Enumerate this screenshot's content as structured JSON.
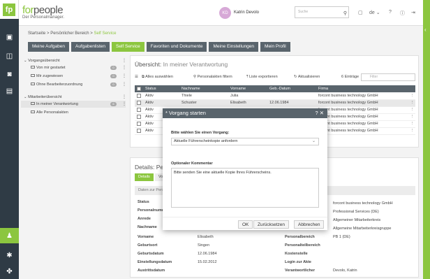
{
  "app": {
    "brand_left": "for",
    "brand_right": "people",
    "tagline": "Der Personalmanager."
  },
  "header": {
    "user_initials": "KD",
    "user_name": "Katrin Devolo",
    "search_placeholder": "Suche",
    "language": "de"
  },
  "breadcrumb": {
    "items": [
      "Startseite",
      "Persönlicher Bereich",
      "Self Service"
    ],
    "separator": ">"
  },
  "tabs": [
    {
      "label": "Meine Aufgaben",
      "active": false
    },
    {
      "label": "Aufgabenlisten",
      "active": false
    },
    {
      "label": "Self Service",
      "active": true
    },
    {
      "label": "Favoriten und Dokumente",
      "active": false
    },
    {
      "label": "Meine Einstellungen",
      "active": false
    },
    {
      "label": "Mein Profil",
      "active": false
    }
  ],
  "tree": {
    "group1": {
      "label": "Vorgangsübersicht",
      "items": [
        {
          "label": "Von mir gestartet",
          "badge": "0"
        },
        {
          "label": "Mir zugewiesen",
          "badge": "0"
        },
        {
          "label": "Ohne Bearbeiterzuordnung",
          "badge": "0"
        }
      ]
    },
    "group2": {
      "label": "Mitarbeiterübersicht",
      "items": [
        {
          "label": "In meiner Verantwortung",
          "badge": "6"
        },
        {
          "label": "Alle Personalakten",
          "badge": ""
        }
      ]
    }
  },
  "overview": {
    "title": "Übersicht:",
    "subtitle": "In meiner Verantwortung",
    "toolbar": {
      "select_all": "Alles auswählen",
      "filter": "Personalakten filtern",
      "export": "Liste exportieren",
      "refresh": "Aktualisieren",
      "count": "6 Einträge",
      "filter_placeholder": "Filter"
    },
    "columns": [
      "Status",
      "Nachname",
      "Vorname",
      "Geb.-Datum",
      "Firma"
    ],
    "rows": [
      [
        "Aktiv",
        "Thiele",
        "Julia",
        "",
        "forcont business technology GmbH"
      ],
      [
        "Aktiv",
        "Schuster",
        "Elisabeth",
        "12.06.1984",
        "forcont business technology GmbH"
      ],
      [
        "Aktiv",
        "",
        "",
        "",
        "forcont business technology GmbH"
      ],
      [
        "Aktiv",
        "",
        "",
        "",
        "forcont business technology GmbH"
      ],
      [
        "Aktiv",
        "",
        "",
        "",
        "forcont business technology GmbH"
      ],
      [
        "Aktiv",
        "",
        "",
        "",
        "forcont business technology GmbH"
      ]
    ]
  },
  "details": {
    "title": "Details: Pers",
    "tabs": [
      "Details",
      "Vo"
    ],
    "section_left": "Daten zur Pers",
    "section_right": "en",
    "left_labels": [
      "Status",
      "Personalnumm",
      "Anrede",
      "Nachname",
      "Vorname",
      "Geburtsort",
      "Geburtsdatum",
      "Einstellungsdatum",
      "Austrittsdatum"
    ],
    "left_values": [
      "",
      "",
      "",
      "",
      "Elisabeth",
      "Singen",
      "12.06.1984",
      "15.02.2012",
      ""
    ],
    "right_labels": [
      "",
      "",
      "",
      "",
      "Personalbereich",
      "Personalteilbereich",
      "Kostenstelle",
      "Login zur Akte",
      "Verantwortlicher"
    ],
    "right_values": [
      "forcont business technology GmbH",
      "Professional Services (DE)",
      "Allgemeiner Mitarbeiterkreis",
      "Allgemeine Mitarbeiterkreisgruppe",
      "PB 1 (DE)",
      "",
      "",
      "",
      "Devolo, Katrin"
    ]
  },
  "modal": {
    "title": "* Vorgang starten",
    "help": "?",
    "close": "✕",
    "select_label": "Bitte wählen Sie einen Vorgang:",
    "select_value": "Aktuelle Führerscheinkopie anfordern",
    "comment_label": "Optionaler Kommentar",
    "comment_value": "Bitte senden Sie eine aktuelle Kopie Ihres Führerscheins.",
    "ok": "OK",
    "reset": "Zurücksetzen",
    "cancel": "Abbrechen"
  }
}
